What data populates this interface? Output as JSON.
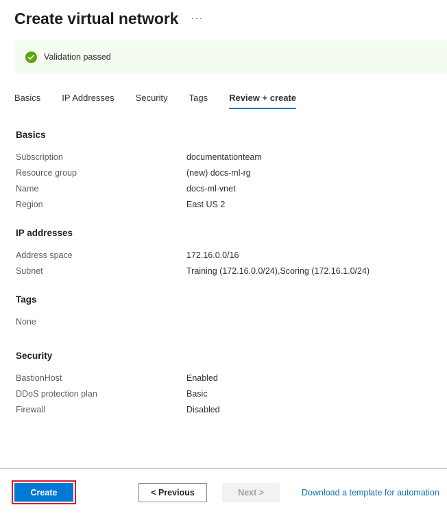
{
  "header": {
    "title": "Create virtual network",
    "ellipsis": "···"
  },
  "validation": {
    "message": "Validation passed",
    "icon": "check-circle-icon",
    "background_color": "#f4fbf0",
    "icon_color": "#5ca511"
  },
  "tabs": [
    {
      "label": "Basics",
      "active": false
    },
    {
      "label": "IP Addresses",
      "active": false
    },
    {
      "label": "Security",
      "active": false
    },
    {
      "label": "Tags",
      "active": false
    },
    {
      "label": "Review + create",
      "active": true
    }
  ],
  "accent_color": "#0078d4",
  "sections": [
    {
      "title": "Basics",
      "rows": [
        {
          "label": "Subscription",
          "value": "documentationteam"
        },
        {
          "label": "Resource group",
          "value": "(new) docs-ml-rg"
        },
        {
          "label": "Name",
          "value": "docs-ml-vnet"
        },
        {
          "label": "Region",
          "value": "East US 2"
        }
      ]
    },
    {
      "title": "IP addresses",
      "rows": [
        {
          "label": "Address space",
          "value": "172.16.0.0/16"
        },
        {
          "label": "Subnet",
          "value": "Training (172.16.0.0/24),Scoring (172.16.1.0/24)"
        }
      ]
    },
    {
      "title": "Tags",
      "empty_text": "None",
      "rows": []
    },
    {
      "title": "Security",
      "rows": [
        {
          "label": "BastionHost",
          "value": "Enabled"
        },
        {
          "label": "DDoS protection plan",
          "value": "Basic"
        },
        {
          "label": "Firewall",
          "value": "Disabled"
        }
      ]
    }
  ],
  "footer": {
    "create_label": "Create",
    "previous_label": "< Previous",
    "next_label": "Next >",
    "download_label": "Download a template for automation",
    "highlight_color": "#e81123",
    "link_color": "#0f6cbd"
  }
}
